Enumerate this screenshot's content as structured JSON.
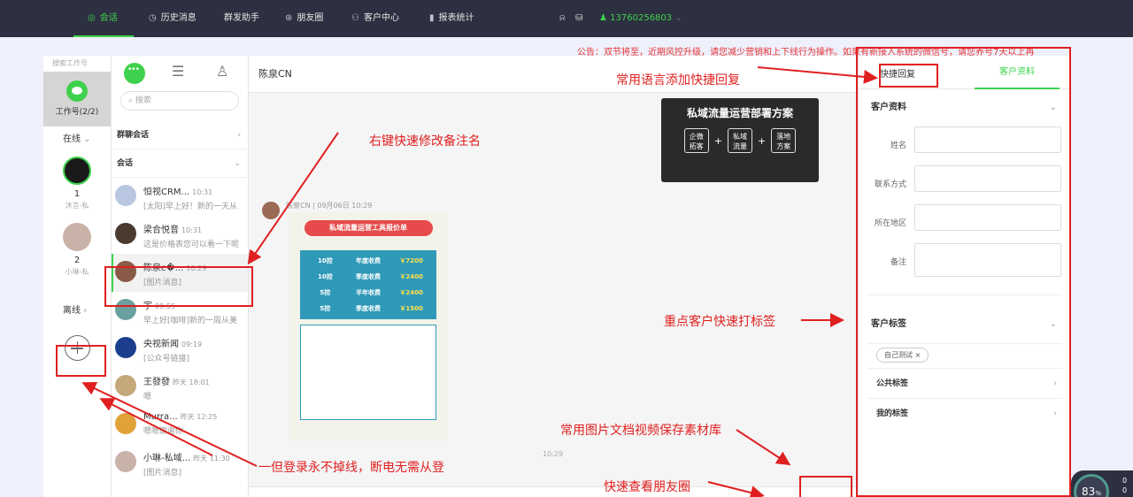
{
  "nav": {
    "items": [
      {
        "label": "会话",
        "icon": "chat-icon",
        "active": true
      },
      {
        "label": "历史消息",
        "icon": "clock-icon"
      },
      {
        "label": "群发助手",
        "icon": ""
      },
      {
        "label": "朋友圈",
        "icon": "moments-icon"
      },
      {
        "label": "客户中心",
        "icon": "user-icon"
      },
      {
        "label": "报表统计",
        "icon": "chart-icon"
      }
    ],
    "phone": "13760256803",
    "accent": "#3fd14d"
  },
  "notice": "公告：双节将至，近期风控升级，请您减少营销和上下线行为操作。如果有新接入系统的微信号，请您养号7天以上再",
  "left": {
    "search_label": "搜索工作号",
    "work_label": "工作号(2/2)",
    "online_label": "在线",
    "accounts": [
      {
        "num": "1",
        "name": "沐言-私"
      },
      {
        "num": "2",
        "name": "小琳-私"
      }
    ],
    "offline_label": "离线"
  },
  "list": {
    "search_placeholder": "搜索",
    "group_chat_label": "群聊会话",
    "chats_label": "会话",
    "conversations": [
      {
        "name": "恒视CRM...",
        "time": "10:31",
        "msg": "[太阳]早上好！新的一天从"
      },
      {
        "name": "梁合悦音",
        "time": "10:31",
        "msg": "这是价格表您可以看一下呢"
      },
      {
        "name": "陈泉c�...",
        "time": "10:29",
        "msg": "[图片消息]"
      },
      {
        "name": "宇",
        "time": "09:55",
        "msg": "早上好[咖啡]新的一周从美"
      },
      {
        "name": "央视新闻",
        "time": "09:19",
        "msg": "[公众号链接]"
      },
      {
        "name": "王發發",
        "time": "昨天 18:01",
        "msg": "嗯"
      },
      {
        "name": "Murra...",
        "time": "昨天 12:25",
        "msg": "嗯嗯谢谢你"
      },
      {
        "name": "小琳-私域...",
        "time": "昨天 11:30",
        "msg": "[图片消息]"
      }
    ]
  },
  "chat": {
    "title": "陈泉CN",
    "sender_line": "陈泉CN | 09月06日 10:29",
    "time": "10:29",
    "card": {
      "title": "私域流量运营部署方案",
      "boxes": [
        "企微\n拓客",
        "私域\n流量",
        "落地\n方案"
      ]
    },
    "poster": {
      "title": "私域流量运营工具报价单",
      "rows": [
        {
          "ctrl": "10控",
          "plan": "年度收费",
          "price": "￥7200"
        },
        {
          "ctrl": "10控",
          "plan": "季度收费",
          "price": "￥2400"
        },
        {
          "ctrl": "5控",
          "plan": "半年收费",
          "price": "￥2400"
        },
        {
          "ctrl": "5控",
          "plan": "季度收费",
          "price": "￥1500"
        }
      ]
    }
  },
  "right": {
    "tab_quick": "快捷回复",
    "tab_profile": "客户资料",
    "profile_title": "客户资料",
    "fields": [
      {
        "label": "姓名"
      },
      {
        "label": "联系方式"
      },
      {
        "label": "所在地区"
      },
      {
        "label": "备注"
      }
    ],
    "tags_title": "客户标签",
    "tag": "自己测试 ×",
    "public_tags": "公共标签",
    "my_tags": "我的标签"
  },
  "annotations": {
    "quick_reply": "常用语言添加快捷回复",
    "rename": "右键快速修改备注名",
    "tagging": "重点客户快速打标签",
    "materials": "常用图片文档视频保存素材库",
    "always_online": "一但登录永不掉线，断电无需从登",
    "moments": "快速查看朋友圈"
  },
  "gauge": {
    "value": "83",
    "unit": "%",
    "side_top": "0",
    "side_bottom": "0"
  }
}
